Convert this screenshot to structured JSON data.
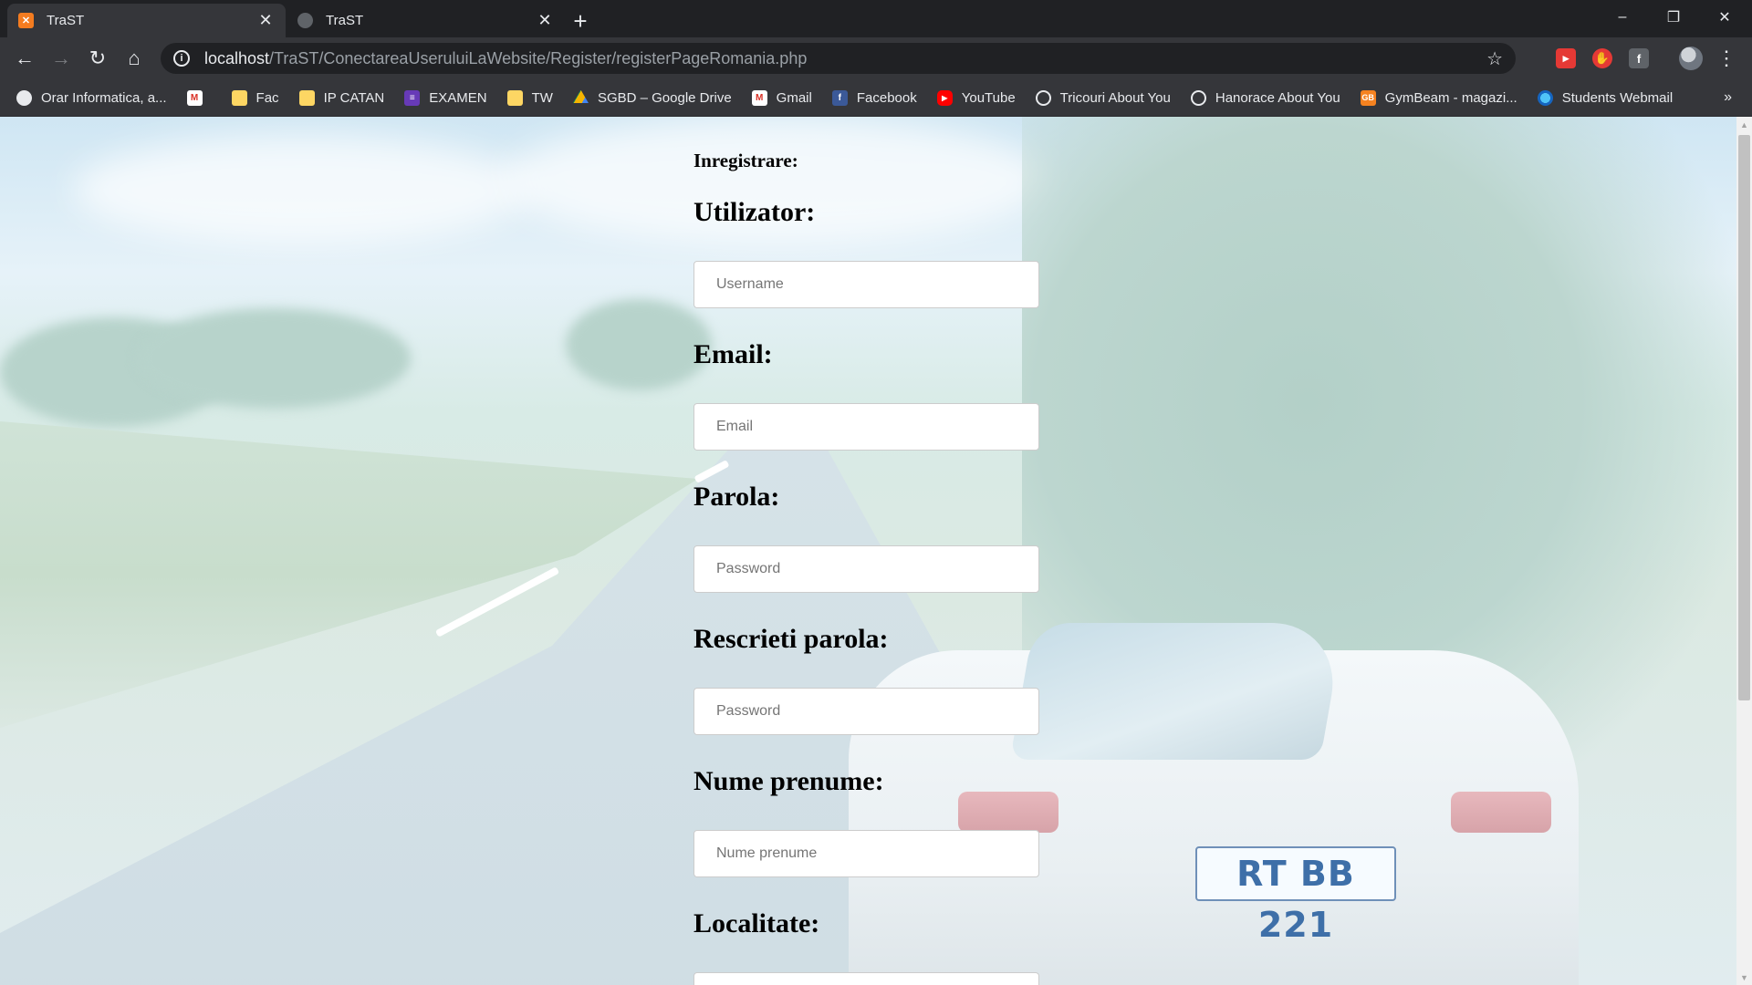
{
  "tabs": [
    {
      "title": "TraST",
      "active": true,
      "favicon": "xampp-icon"
    },
    {
      "title": "TraST",
      "active": false,
      "favicon": "globe-icon"
    }
  ],
  "window_controls": {
    "minimize": "–",
    "restore": "❐",
    "close": "✕"
  },
  "toolbar": {
    "url_host": "localhost",
    "url_path": "/TraST/ConectareaUseruluiLaWebsite/Register/registerPageRomania.php"
  },
  "bookmarks": [
    {
      "label": "Orar Informatica, a...",
      "icon": "globe-icon"
    },
    {
      "label": "",
      "icon": "gmail-icon"
    },
    {
      "label": "Fac",
      "icon": "folder-icon"
    },
    {
      "label": "IP CATAN",
      "icon": "folder-icon"
    },
    {
      "label": "EXAMEN",
      "icon": "forms-icon"
    },
    {
      "label": "TW",
      "icon": "folder-icon"
    },
    {
      "label": "SGBD – Google Drive",
      "icon": "drive-icon"
    },
    {
      "label": "Gmail",
      "icon": "gmail-icon"
    },
    {
      "label": "Facebook",
      "icon": "facebook-icon"
    },
    {
      "label": "YouTube",
      "icon": "youtube-icon"
    },
    {
      "label": "Tricouri About You",
      "icon": "aboutyou-icon"
    },
    {
      "label": "Hanorace About You",
      "icon": "aboutyou-icon"
    },
    {
      "label": "GymBeam - magazi...",
      "icon": "gymbeam-icon"
    },
    {
      "label": "Students Webmail",
      "icon": "webmail-icon"
    }
  ],
  "bookmarks_more": "»",
  "form": {
    "title": "Inregistrare:",
    "fields": [
      {
        "label": "Utilizator:",
        "placeholder": "Username"
      },
      {
        "label": "Email:",
        "placeholder": "Email"
      },
      {
        "label": "Parola:",
        "placeholder": "Password"
      },
      {
        "label": "Rescrieti parola:",
        "placeholder": "Password"
      },
      {
        "label": "Nume prenume:",
        "placeholder": "Nume prenume"
      },
      {
        "label": "Localitate:",
        "placeholder": ""
      }
    ]
  },
  "background": {
    "plate_text": "RT BB 221"
  }
}
